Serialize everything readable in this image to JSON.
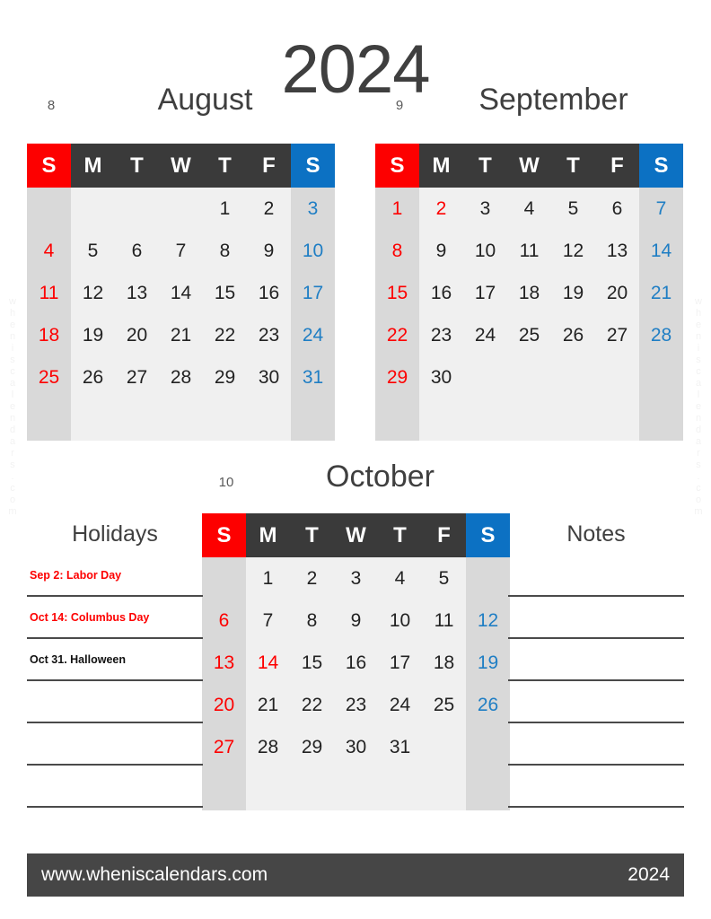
{
  "year": "2024",
  "watermark": "wheniscalendars.com",
  "weekdays": [
    "S",
    "M",
    "T",
    "W",
    "T",
    "F",
    "S"
  ],
  "months": [
    {
      "id": "august",
      "number": "8",
      "name": "August",
      "weeks": [
        [
          "",
          "",
          "",
          "",
          "1",
          "2",
          "3"
        ],
        [
          "4",
          "5",
          "6",
          "7",
          "8",
          "9",
          "10"
        ],
        [
          "11",
          "12",
          "13",
          "14",
          "15",
          "16",
          "17"
        ],
        [
          "18",
          "19",
          "20",
          "21",
          "22",
          "23",
          "24"
        ],
        [
          "25",
          "26",
          "27",
          "28",
          "29",
          "30",
          "31"
        ],
        [
          "",
          "",
          "",
          "",
          "",
          "",
          ""
        ]
      ],
      "holiday_days": []
    },
    {
      "id": "september",
      "number": "9",
      "name": "September",
      "weeks": [
        [
          "1",
          "2",
          "3",
          "4",
          "5",
          "6",
          "7"
        ],
        [
          "8",
          "9",
          "10",
          "11",
          "12",
          "13",
          "14"
        ],
        [
          "15",
          "16",
          "17",
          "18",
          "19",
          "20",
          "21"
        ],
        [
          "22",
          "23",
          "24",
          "25",
          "26",
          "27",
          "28"
        ],
        [
          "29",
          "30",
          "",
          "",
          "",
          "",
          ""
        ],
        [
          "",
          "",
          "",
          "",
          "",
          "",
          ""
        ]
      ],
      "holiday_days": [
        "2"
      ]
    },
    {
      "id": "october",
      "number": "10",
      "name": "October",
      "weeks": [
        [
          "",
          "1",
          "2",
          "3",
          "4",
          "5",
          ""
        ],
        [
          "6",
          "7",
          "8",
          "9",
          "10",
          "11",
          "12"
        ],
        [
          "13",
          "14",
          "15",
          "16",
          "17",
          "18",
          "19"
        ],
        [
          "20",
          "21",
          "22",
          "23",
          "24",
          "25",
          "26"
        ],
        [
          "27",
          "28",
          "29",
          "30",
          "31",
          "",
          ""
        ],
        [
          "",
          "",
          "",
          "",
          "",
          "",
          ""
        ]
      ],
      "holiday_days": [
        "14"
      ]
    }
  ],
  "holidays_panel": {
    "title": "Holidays",
    "rows": [
      {
        "text": "Sep 2: Labor Day",
        "red": true
      },
      {
        "text": "Oct 14: Columbus Day",
        "red": true
      },
      {
        "text": "Oct 31. Halloween",
        "red": false
      },
      {
        "text": "",
        "red": false
      },
      {
        "text": "",
        "red": false
      },
      {
        "text": "",
        "red": false
      }
    ]
  },
  "notes_panel": {
    "title": "Notes",
    "rows": [
      {
        "text": "",
        "red": false
      },
      {
        "text": "",
        "red": false
      },
      {
        "text": "",
        "red": false
      },
      {
        "text": "",
        "red": false
      },
      {
        "text": "",
        "red": false
      },
      {
        "text": "",
        "red": false
      }
    ]
  },
  "footer": {
    "website": "www.wheniscalendars.com",
    "year": "2024"
  },
  "colors": {
    "sunday_header": "#fd0000",
    "saturday_header": "#0c71c3",
    "weekday_header": "#3a3a3a",
    "weekend_column": "#d9d9d9",
    "body": "#f0f0f0",
    "footer": "#464646",
    "text_dark": "#3f3f3f"
  }
}
